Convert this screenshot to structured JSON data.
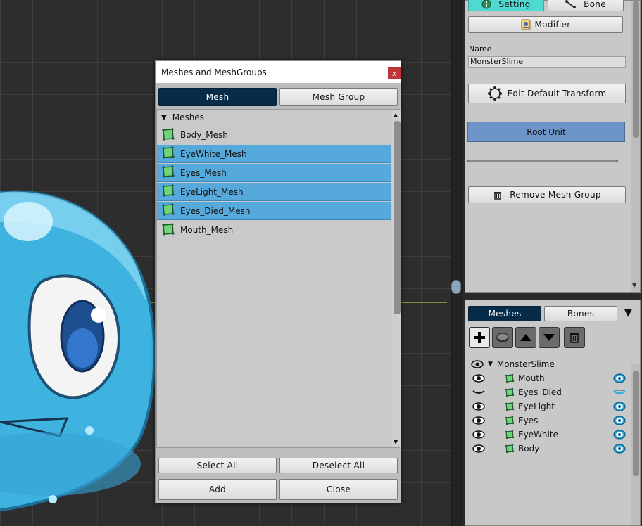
{
  "inspector": {
    "setting_tab": "Setting",
    "bone_tab": "Bone",
    "modifier_button": "Modifier",
    "name_label": "Name",
    "name_value": "MonsterSlime",
    "edit_default_transform": "Edit Default Transform",
    "root_unit": "Root Unit",
    "remove_mesh_group": "Remove Mesh Group"
  },
  "hierarchy": {
    "tabs": [
      "Meshes",
      "Bones"
    ],
    "root": "MonsterSlime",
    "items": [
      {
        "label": "Mouth",
        "visible": true
      },
      {
        "label": "Eyes_Died",
        "visible": false
      },
      {
        "label": "EyeLight",
        "visible": true
      },
      {
        "label": "Eyes",
        "visible": true
      },
      {
        "label": "EyeWhite",
        "visible": true
      },
      {
        "label": "Body",
        "visible": true
      }
    ]
  },
  "dialog": {
    "title": "Meshes and MeshGroups",
    "close_glyph": "x",
    "tabs": [
      "Mesh",
      "Mesh Group"
    ],
    "list_header": "Meshes",
    "meshes": [
      {
        "label": "Body_Mesh",
        "selected": false
      },
      {
        "label": "EyeWhite_Mesh",
        "selected": true
      },
      {
        "label": "Eyes_Mesh",
        "selected": true
      },
      {
        "label": "EyeLight_Mesh",
        "selected": true
      },
      {
        "label": "Eyes_Died_Mesh",
        "selected": true
      },
      {
        "label": "Mouth_Mesh",
        "selected": false
      }
    ],
    "select_all": "Select All",
    "deselect_all": "Deselect All",
    "add": "Add",
    "close": "Close"
  },
  "colors": {
    "selected_row": "#55aadb",
    "active_tab": "#062c4a",
    "root_unit": "#6d95c8",
    "setting_tab": "#4fd9d0"
  }
}
